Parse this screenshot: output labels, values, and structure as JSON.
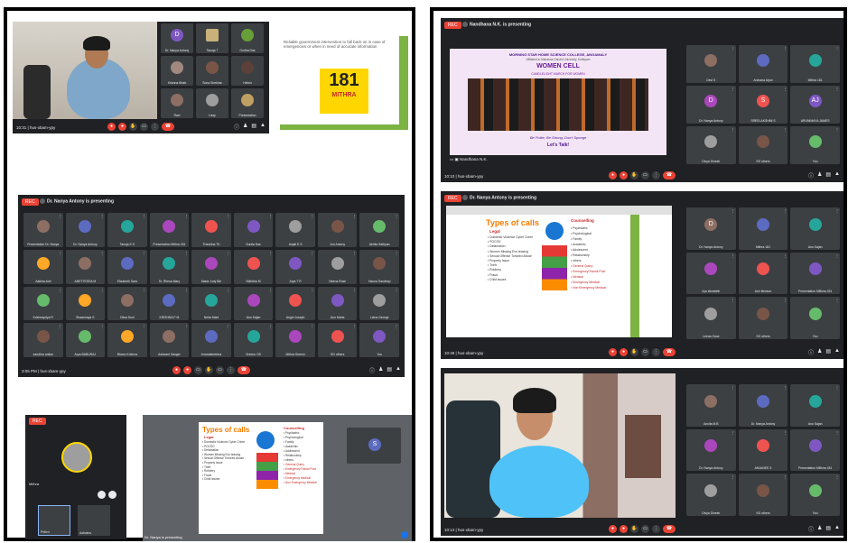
{
  "shot1": {
    "time": "10:31",
    "meet_code": "hus-xbam-ypy",
    "tiles": [
      "Dr. Nanya Antony",
      "Tanuja 7",
      "Godha Das",
      "Krishna Bhatt",
      "Sona Shekhar",
      "Helvin",
      "Ravi",
      "Lissy",
      "Presentation"
    ],
    "slide_text": "Reliable government intervention to fall back on in case of emergencies or when in need of accurate information",
    "logo_number": "181",
    "logo_sub": "MITHRA"
  },
  "shot2": {
    "rec": "REC",
    "presenting": "Dr. Nanya Antony is presenting",
    "time": "3:05 PM",
    "meet_code": "hus-xbam-ypy",
    "tiles": [
      "Presentation Dr. Nanya",
      "Dr. Nanya Antony",
      "Tanuja K S",
      "Presentation Mithra 181",
      "Thashina TK",
      "Sunila Das",
      "Anjali E S",
      "Jon Antony",
      "Akhila Sathyan",
      "Aathira Anil",
      "ANETTESSA M",
      "Elizabeth Sara",
      "Sr. Rhesa Mary",
      "Maria Judy Bin",
      "Nikhitha M",
      "Arya T R",
      "Neena Rose",
      "Hanna Sandeep",
      "Krishnapriya R",
      "Shaannaya S",
      "Dilna Suni",
      "KRISHNA P M",
      "Neha Mani",
      "Anu Sajan",
      "Angel Joseph",
      "Ann Maria",
      "Liana George",
      "sandhra anilan",
      "Arya BABURAJ",
      "Bhanu Krishna",
      "Ashwani Sanger",
      "Anandakrishna",
      "Sreenu CB",
      "Mithra Sreesh",
      "SG others",
      "You"
    ]
  },
  "shot3": {
    "mini_label": "Mithra",
    "self_name": "Prithvi",
    "self_name2": "Ashwinu",
    "bottom_presenting": "Dr. Nanya is presenting",
    "s_letter": "S",
    "slide_title": "Types of calls",
    "legal": "Legal",
    "left_items": [
      "Domestic Violence Cyber Crime",
      "POCSO",
      "Defamation",
      "Women Missing Eve teasing",
      "Sexual Offense Tortured Abuse",
      "Property Issue",
      "Theft",
      "Robbery",
      "Fraud",
      "Child issues"
    ],
    "counselling": "Counselling",
    "right_items": [
      "Psychiatric",
      "Psychological",
      "Family",
      "Academic",
      "Adolescent",
      "Relationship",
      "others",
      "General Query",
      "Emergency/Transit Post",
      "Medical",
      "Emergency Medical",
      "Non Emergency Medical"
    ]
  },
  "shot4": {
    "rec": "REC",
    "presenting": "Nandhana N.K. is presenting",
    "time": "10:10",
    "meet_code": "hus-xbam-ypy",
    "presenter_label": "Nandhana N.K.",
    "college": "MORNING STAR HOME SCIENCE COLLEGE, ANGAMALY",
    "college_sub": "Affiliated to Mahatma Gandhi University, Kottayam",
    "cell": "WOMEN CELL",
    "event": "CANDLELIGHT MARCH FOR WOMEN",
    "footer_quote": "Be Polite, Be Strong, Don't Sponge",
    "footer_line": "Let's Talk!",
    "tiles": [
      "Devi S",
      "Archana Arjun",
      "Mithra 181",
      "Dr. Nanya Antony",
      "SREELAKSHMI S",
      "ARUNIMAYA JAMES",
      "Divya Dinesh",
      "SG others",
      "You"
    ],
    "letters": [
      "",
      "",
      "",
      "D",
      "S",
      "AJ",
      "",
      "",
      ""
    ]
  },
  "shot5": {
    "rec": "REC",
    "presenting": "Dr. Nanya Antony is presenting",
    "time": "10:49",
    "meet_code": "hus-xbam-ypy",
    "slide_title": "Types of calls",
    "legal": "Legal",
    "counselling": "Counselling",
    "left_items": [
      "Domestic Violence Cyber Crime",
      "POCSO",
      "Defamation",
      "Women Missing Eve teasing",
      "Sexual Offense Tortured Abuse",
      "Property Issue",
      "Theft",
      "Robbery",
      "Fraud",
      "Child issues"
    ],
    "right_items": [
      "Psychiatric",
      "Psychological",
      "Family",
      "Academic",
      "Adolescent",
      "Relationship",
      "others",
      "General Query",
      "Emergency/Transit Post",
      "Medical",
      "Emergency Medical",
      "Non Emergency Medical"
    ],
    "tiles": [
      "Dr. Nanya Antony",
      "Mithra 181",
      "Anu Sajan",
      "riya elizabeth",
      "Ann Benson",
      "Presentation MBhira 181",
      "Leena Ouse",
      "SG others",
      "You"
    ],
    "letters": [
      "D",
      "",
      "",
      "",
      "",
      "",
      "",
      "",
      ""
    ]
  },
  "shot6": {
    "time": "10:14",
    "meet_code": "hus-xbam-ypy",
    "tiles": [
      "Ancita M.B",
      "Dr. Nanya Antony",
      "Anu Sajan",
      "Dr. Nanya Antony",
      "ANJANEE S",
      "Presentation MBhira 181",
      "Divya Dinesh",
      "SG others",
      "You"
    ]
  }
}
